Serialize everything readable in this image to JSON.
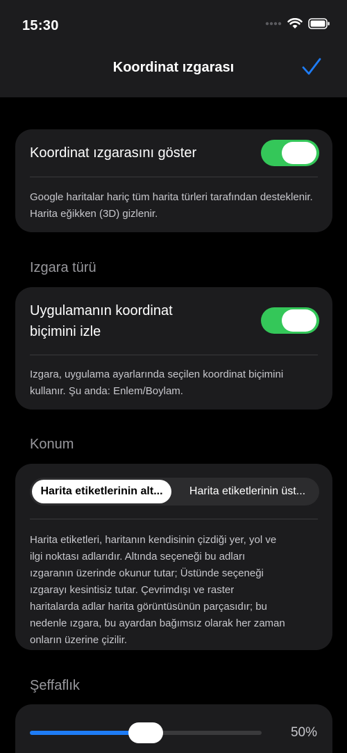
{
  "status_bar": {
    "time": "15:30",
    "icons": [
      "signal-dots-icon",
      "wifi-icon",
      "battery-icon"
    ]
  },
  "nav": {
    "title": "Koordinat ızgarası",
    "done_icon": "checkmark-icon"
  },
  "show_grid": {
    "label": "Koordinat ızgarasını göster",
    "enabled": true,
    "footnote": "Google haritalar hariç tüm harita türleri tarafından desteklenir. Harita eğikken (3D) gizlenir."
  },
  "grid_type": {
    "header": "Izgara türü",
    "label_line1": "Uygulamanın koordinat",
    "label_line2": "biçimini izle",
    "enabled": true,
    "footnote_line1": "Izgara, uygulama ayarlarında seçilen koordinat biçimini",
    "footnote_line2": "kullanır. Şu anda: Enlem/Boylam."
  },
  "position": {
    "header": "Konum",
    "options": [
      "Harita etiketlerinin alt...",
      "Harita etiketlerinin üst..."
    ],
    "selected_index": 0,
    "footnote_lines": [
      "Harita etiketleri, haritanın kendisinin çizdiği yer, yol ve",
      "ilgi noktası adlarıdır. Altında seçeneği bu adları",
      "ızgaranın üzerinde okunur tutar; Üstünde seçeneği",
      "ızgarayı kesintisiz tutar. Çevrimdışı ve raster",
      "haritalarda adlar harita görüntüsünün parçasıdır; bu",
      "nedenle ızgara, bu ayardan bağımsız olarak her zaman",
      "onların üzerine çizilir."
    ]
  },
  "opacity": {
    "header": "Şeffaflık",
    "value": 0.5,
    "value_label": "50%"
  },
  "colors": {
    "accent": "#1e7cf5",
    "toggle_on": "#34c759",
    "card_bg": "#1c1c1e",
    "background": "#000000"
  }
}
